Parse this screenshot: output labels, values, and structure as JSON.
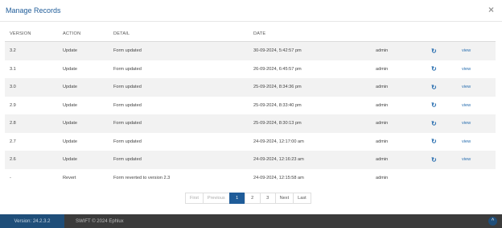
{
  "modal": {
    "title": "Manage Records",
    "close_label": "×"
  },
  "table": {
    "headers": [
      "VERSION",
      "ACTION",
      "DETAIL",
      "DATE"
    ],
    "rows": [
      {
        "version": "3.2",
        "action": "Update",
        "detail": "Form updated",
        "date": "30-09-2024, 5:42:57 pm",
        "user": "admin",
        "revert": "↻",
        "view": "view"
      },
      {
        "version": "3.1",
        "action": "Update",
        "detail": "Form updated",
        "date": "26-09-2024, 6:45:57 pm",
        "user": "admin",
        "revert": "↻",
        "view": "view"
      },
      {
        "version": "3.0",
        "action": "Update",
        "detail": "Form updated",
        "date": "25-09-2024, 8:34:36 pm",
        "user": "admin",
        "revert": "↻",
        "view": "view"
      },
      {
        "version": "2.9",
        "action": "Update",
        "detail": "Form updated",
        "date": "25-09-2024, 8:33:40 pm",
        "user": "admin",
        "revert": "↻",
        "view": "view"
      },
      {
        "version": "2.8",
        "action": "Update",
        "detail": "Form updated",
        "date": "25-09-2024, 8:30:13 pm",
        "user": "admin",
        "revert": "↻",
        "view": "view"
      },
      {
        "version": "2.7",
        "action": "Update",
        "detail": "Form updated",
        "date": "24-09-2024, 12:17:00 am",
        "user": "admin",
        "revert": "↻",
        "view": "view"
      },
      {
        "version": "2.6",
        "action": "Update",
        "detail": "Form updated",
        "date": "24-09-2024, 12:16:23 am",
        "user": "admin",
        "revert": "↻",
        "view": "view"
      },
      {
        "version": "-",
        "action": "Revert",
        "detail": "Form reverted to version 2.3",
        "date": "24-09-2024, 12:15:58 am",
        "user": "admin",
        "revert": "",
        "view": ""
      }
    ]
  },
  "pagination": {
    "first": "First",
    "previous": "Previous",
    "pages": [
      "1",
      "2",
      "3"
    ],
    "current": "1",
    "next": "Next",
    "last": "Last"
  },
  "footer": {
    "version": "Version: 24.2.3.2",
    "copyright": "SWIFT © 2024 Ephlux",
    "scroll_top": "^"
  },
  "colors": {
    "accent": "#1f5c99",
    "link": "#2a6fb0",
    "footer_bg": "#3b3b3b"
  }
}
